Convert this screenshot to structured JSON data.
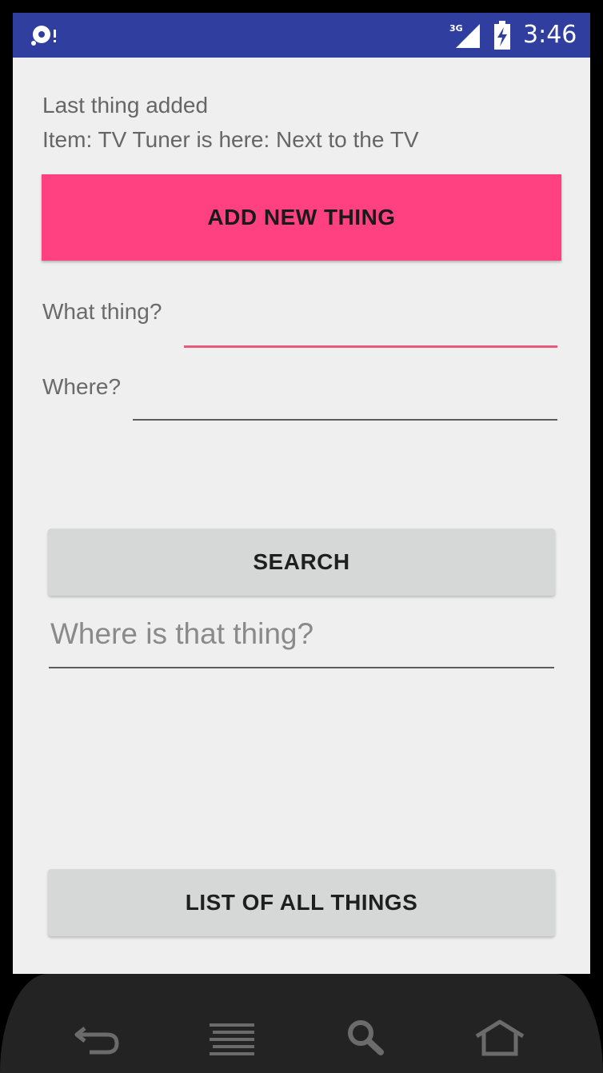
{
  "status_bar": {
    "network": "3G",
    "time": "3:46",
    "left_icon": "sync-disc-icon",
    "color": "#303f9f"
  },
  "last_added": {
    "title": "Last thing added",
    "item_text": "Item: TV Tuner is here: Next to the TV"
  },
  "add_button": {
    "label": "ADD NEW THING",
    "color": "#ff4081"
  },
  "form": {
    "what_label": "What thing?",
    "what_value": "",
    "where_label": "Where?",
    "where_value": ""
  },
  "search_button": {
    "label": "SEARCH"
  },
  "search_input": {
    "placeholder": "Where is that thing?",
    "value": ""
  },
  "list_button": {
    "label": "LIST OF ALL THINGS"
  },
  "nav_bar": {
    "icons": [
      "back-icon",
      "menu-icon",
      "search-icon",
      "home-icon"
    ]
  }
}
